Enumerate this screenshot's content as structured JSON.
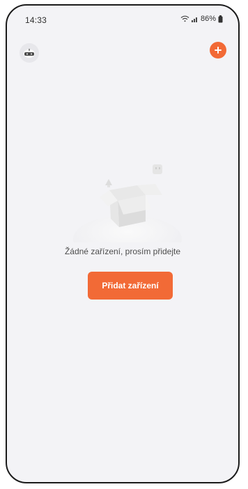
{
  "status_bar": {
    "time": "14:33",
    "battery": "86%",
    "icons": [
      "wifi-icon",
      "signal-icon",
      "battery-icon"
    ]
  },
  "header": {
    "left_icon": "avatar-robot-icon",
    "right_icon": "plus-icon"
  },
  "empty_state": {
    "illustration": "empty-box-icon",
    "message": "Žádné zařízení, prosím přidejte",
    "button_label": "Přidat zařízení"
  },
  "colors": {
    "accent": "#f26a36",
    "background": "#f3f3f6",
    "text": "#4d4d4d"
  }
}
